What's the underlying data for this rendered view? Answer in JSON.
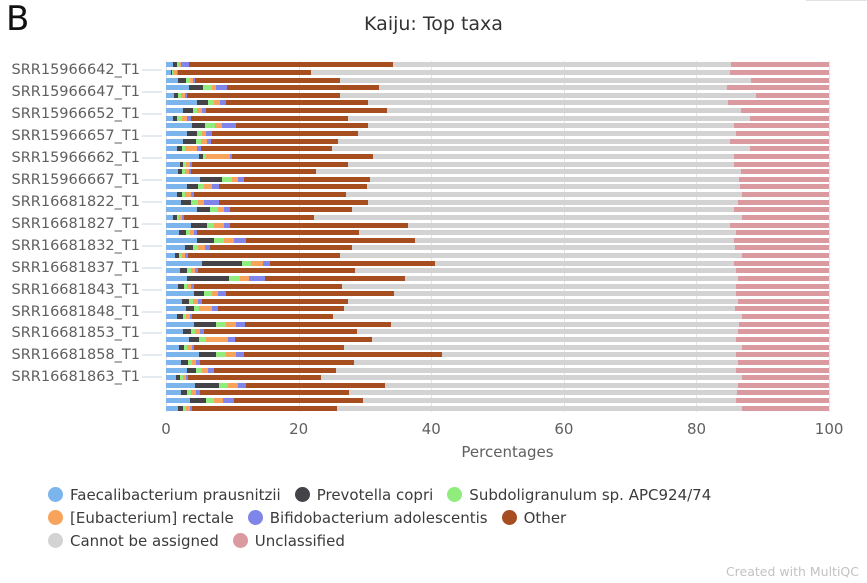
{
  "panel": {
    "letter": "B"
  },
  "header": {
    "title": "Kaiju: Top taxa"
  },
  "footer": {
    "text": "Created with MultiQC"
  },
  "axes": {
    "x": {
      "title": "Percentages",
      "ticks": [
        0,
        20,
        40,
        60,
        80,
        100
      ],
      "tick_labels": [
        "0",
        "20",
        "40",
        "60",
        "80",
        "100"
      ],
      "min": 0,
      "max": 103
    },
    "y": {
      "labels": [
        "SRR15966642_T1",
        "SRR15966647_T1",
        "SRR15966652_T1",
        "SRR15966657_T1",
        "SRR15966662_T1",
        "SRR15966667_T1",
        "SRR16681822_T1",
        "SRR16681827_T1",
        "SRR16681832_T1",
        "SRR16681837_T1",
        "SRR16681843_T1",
        "SRR16681848_T1",
        "SRR16681853_T1",
        "SRR16681858_T1",
        "SRR16681863_T1"
      ]
    }
  },
  "legend": {
    "rows": [
      [
        {
          "label": "Faecalibacterium prausnitzii",
          "color": "#7cb5ec",
          "key": "faecalibacterium"
        },
        {
          "label": "Prevotella copri",
          "color": "#434348",
          "key": "prevotella"
        },
        {
          "label": "Subdoligranulum sp. APC924/74",
          "color": "#90ed7d",
          "key": "subdoligranulum"
        }
      ],
      [
        {
          "label": "[Eubacterium] rectale",
          "color": "#f7a35c",
          "key": "eubacterium"
        },
        {
          "label": "Bifidobacterium adolescentis",
          "color": "#8085e9",
          "key": "bifidobacterium"
        },
        {
          "label": "Other",
          "color": "#a74e21",
          "key": "other"
        }
      ],
      [
        {
          "label": "Cannot be assigned",
          "color": "#d3d3d3",
          "key": "cannot_assigned"
        },
        {
          "label": "Unclassified",
          "color": "#da9a9f",
          "key": "unclassified"
        }
      ]
    ]
  },
  "chart_data": {
    "type": "bar",
    "orientation": "horizontal",
    "stacked": true,
    "stack_mode": "percent",
    "title": "Kaiju: Top taxa",
    "xlabel": "Percentages",
    "ylabel": "",
    "xlim": [
      0,
      103
    ],
    "grid": true,
    "legend_position": "bottom",
    "series": [
      {
        "name": "Faecalibacterium prausnitzii",
        "color": "#7cb5ec"
      },
      {
        "name": "Prevotella copri",
        "color": "#434348"
      },
      {
        "name": "Subdoligranulum sp. APC924/74",
        "color": "#90ed7d"
      },
      {
        "name": "[Eubacterium] rectale",
        "color": "#f7a35c"
      },
      {
        "name": "Bifidobacterium adolescentis",
        "color": "#8085e9"
      },
      {
        "name": "Other",
        "color": "#a74e21"
      },
      {
        "name": "Cannot be assigned",
        "color": "#d3d3d3"
      },
      {
        "name": "Unclassified",
        "color": "#da9a9f"
      }
    ],
    "categories": [
      "SRR15966642_T1",
      "SRR15966647_T1",
      "SRR15966652_T1",
      "SRR15966657_T1",
      "SRR15966662_T1",
      "SRR15966667_T1",
      "SRR16681822_T1",
      "SRR16681827_T1",
      "SRR16681832_T1",
      "SRR16681837_T1",
      "SRR16681843_T1",
      "SRR16681848_T1",
      "SRR16681853_T1",
      "SRR16681858_T1",
      "SRR16681863_T1"
    ],
    "rows": [
      {
        "values": [
          1.0,
          0.6,
          0.4,
          0.3,
          1.2,
          30.8,
          50.9,
          14.8
        ]
      },
      {
        "values": [
          0.7,
          0.2,
          0.2,
          0.5,
          0.2,
          20.0,
          63.2,
          15.0
        ]
      },
      {
        "values": [
          1.8,
          1.2,
          0.6,
          0.5,
          0.3,
          21.8,
          62.1,
          11.7
        ]
      },
      {
        "values": [
          3.4,
          2.2,
          1.4,
          0.5,
          1.7,
          23.0,
          52.4,
          15.4
        ]
      },
      {
        "values": [
          1.2,
          0.6,
          0.4,
          0.6,
          0.3,
          23.2,
          62.7,
          11.0
        ]
      },
      {
        "values": [
          4.6,
          1.7,
          1.0,
          0.8,
          1.0,
          21.3,
          54.4,
          15.2
        ]
      },
      {
        "values": [
          2.5,
          1.6,
          0.6,
          0.7,
          0.6,
          27.3,
          53.4,
          13.3
        ]
      },
      {
        "values": [
          1.0,
          0.6,
          0.8,
          0.7,
          0.6,
          23.8,
          60.6,
          11.9
        ]
      },
      {
        "values": [
          3.9,
          2.0,
          1.5,
          1.1,
          2.0,
          20.0,
          55.2,
          14.3
        ]
      },
      {
        "values": [
          3.2,
          1.4,
          0.8,
          0.7,
          0.8,
          22.1,
          57.0,
          14.0
        ]
      },
      {
        "values": [
          2.6,
          1.9,
          0.8,
          0.9,
          0.6,
          19.2,
          59.1,
          14.9
        ]
      },
      {
        "values": [
          1.6,
          0.8,
          0.5,
          1.8,
          0.6,
          19.8,
          63.0,
          11.9
        ]
      },
      {
        "values": [
          5.0,
          0.6,
          0.4,
          3.6,
          0.4,
          21.3,
          54.3,
          14.4
        ]
      },
      {
        "values": [
          2.1,
          0.5,
          0.4,
          0.6,
          0.4,
          23.5,
          58.2,
          14.3
        ]
      },
      {
        "values": [
          1.8,
          0.6,
          0.4,
          0.7,
          0.3,
          18.9,
          64.0,
          13.3
        ]
      },
      {
        "values": [
          5.1,
          3.4,
          1.4,
          1.0,
          0.8,
          19.0,
          55.7,
          13.6
        ]
      },
      {
        "values": [
          3.2,
          1.6,
          0.9,
          1.3,
          1.0,
          22.3,
          56.3,
          13.4
        ]
      },
      {
        "values": [
          1.6,
          0.8,
          0.5,
          0.8,
          0.6,
          22.9,
          59.6,
          13.2
        ]
      },
      {
        "values": [
          2.2,
          1.6,
          1.0,
          1.0,
          2.2,
          22.5,
          55.7,
          13.8
        ]
      },
      {
        "values": [
          4.6,
          2.1,
          1.2,
          0.9,
          0.8,
          18.5,
          57.6,
          14.3
        ]
      },
      {
        "values": [
          1.1,
          0.5,
          0.4,
          0.4,
          0.3,
          19.6,
          64.6,
          13.1
        ]
      },
      {
        "values": [
          3.8,
          2.4,
          1.1,
          1.4,
          1.0,
          26.8,
          48.6,
          14.9
        ]
      },
      {
        "values": [
          2.0,
          1.0,
          0.6,
          0.6,
          0.5,
          24.4,
          56.8,
          14.1
        ]
      },
      {
        "values": [
          4.7,
          2.5,
          1.6,
          1.5,
          1.8,
          25.5,
          48.0,
          14.4
        ]
      },
      {
        "values": [
          2.8,
          1.3,
          0.8,
          1.0,
          0.7,
          21.4,
          57.8,
          14.2
        ]
      },
      {
        "values": [
          1.4,
          0.6,
          0.4,
          0.5,
          0.4,
          22.9,
          60.6,
          13.2
        ]
      },
      {
        "values": [
          5.5,
          5.9,
          1.4,
          1.9,
          1.0,
          24.9,
          45.1,
          14.3
        ]
      },
      {
        "values": [
          2.1,
          1.0,
          0.6,
          0.7,
          0.5,
          23.6,
          57.5,
          14.0
        ]
      },
      {
        "values": [
          3.2,
          6.3,
          1.6,
          1.4,
          2.4,
          21.1,
          50.2,
          13.8
        ]
      },
      {
        "values": [
          1.8,
          0.9,
          0.5,
          0.6,
          0.4,
          22.4,
          59.4,
          14.0
        ]
      },
      {
        "values": [
          4.2,
          1.6,
          1.1,
          1.0,
          1.2,
          25.3,
          51.5,
          14.1
        ]
      },
      {
        "values": [
          2.4,
          1.0,
          0.7,
          0.8,
          0.6,
          22.0,
          58.7,
          13.8
        ]
      },
      {
        "values": [
          3.0,
          1.2,
          0.8,
          1.9,
          0.9,
          19.0,
          59.0,
          14.2
        ]
      },
      {
        "values": [
          1.7,
          0.8,
          0.5,
          0.6,
          0.4,
          21.2,
          61.6,
          13.2
        ]
      },
      {
        "values": [
          4.2,
          3.3,
          1.5,
          1.6,
          1.3,
          22.1,
          52.4,
          13.6
        ]
      },
      {
        "values": [
          2.6,
          1.1,
          0.7,
          0.8,
          0.6,
          23.0,
          57.4,
          13.8
        ]
      },
      {
        "values": [
          3.5,
          1.5,
          1.0,
          3.4,
          1.0,
          20.6,
          54.9,
          14.1
        ]
      },
      {
        "values": [
          1.9,
          0.8,
          0.5,
          0.7,
          0.4,
          22.6,
          59.9,
          13.2
        ]
      },
      {
        "values": [
          5.0,
          2.6,
          1.5,
          1.4,
          1.2,
          29.9,
          44.3,
          14.1
        ]
      },
      {
        "values": [
          2.3,
          1.0,
          0.6,
          0.7,
          0.5,
          23.3,
          57.8,
          13.8
        ]
      },
      {
        "values": [
          3.1,
          1.4,
          0.9,
          1.0,
          0.8,
          18.4,
          60.4,
          14.0
        ]
      },
      {
        "values": [
          1.5,
          0.6,
          0.4,
          0.5,
          0.3,
          20.1,
          63.4,
          13.2
        ]
      },
      {
        "values": [
          4.4,
          3.6,
          1.4,
          1.5,
          1.1,
          21.0,
          53.3,
          13.7
        ]
      },
      {
        "values": [
          2.2,
          1.0,
          0.6,
          0.8,
          0.5,
          22.5,
          58.5,
          13.9
        ]
      },
      {
        "values": [
          3.6,
          2.4,
          1.3,
          1.3,
          1.6,
          19.5,
          56.2,
          14.1
        ]
      },
      {
        "values": [
          1.8,
          0.7,
          0.5,
          0.6,
          0.4,
          21.8,
          61.0,
          13.2
        ]
      }
    ],
    "row_groups": 16,
    "rows_per_group": 3,
    "note": "Stacked horizontal percentage bars; each sample label marks a group of thin bars."
  }
}
